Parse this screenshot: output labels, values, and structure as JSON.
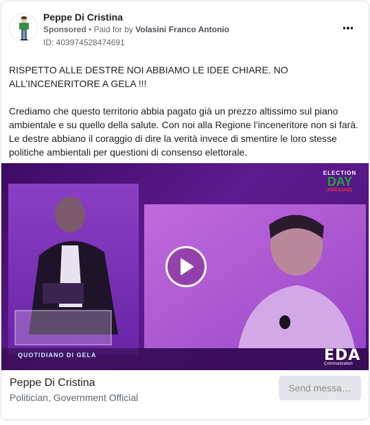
{
  "post": {
    "author": "Peppe Di Cristina",
    "sponsored_label": "Sponsored",
    "paid_prefix": "• Paid for by",
    "payer": "Volasini Franco Antonio",
    "ad_id": "ID: 403974528474691",
    "more_icon": "more-horizontal-icon",
    "text": {
      "headline": "RISPETTO ALLE DESTRE NOI ABBIAMO LE IDEE CHIARE. NO ALL’INCENERITORE A GELA !!!",
      "body": "Crediamo che questo territorio abbia pagato già un prezzo altissimo sul piano ambientale e su quello della salute. Con noi alla Regione l’inceneritore non si farà. Le destre abbiano il coraggio di dire la verità invece di smentire le loro stesse politiche ambientali per questioni di consenso elettorale."
    }
  },
  "video": {
    "play_icon": "play-icon",
    "overlay_top": {
      "line1": "ELECTION",
      "line2": "DAY",
      "line3": "#SICILIA22"
    },
    "overlay_bottom_left": "QUOTIDIANO DI GELA",
    "overlay_bottom_right": {
      "big": "EDA",
      "small": "Communication"
    }
  },
  "footer": {
    "page_name": "Peppe Di Cristina",
    "page_category": "Politician, Government Official",
    "cta_label": "Send messa…"
  },
  "colors": {
    "video_bg": "#4a127a",
    "cta_bg": "#e4e6eb",
    "cta_text": "#8a8d91"
  }
}
